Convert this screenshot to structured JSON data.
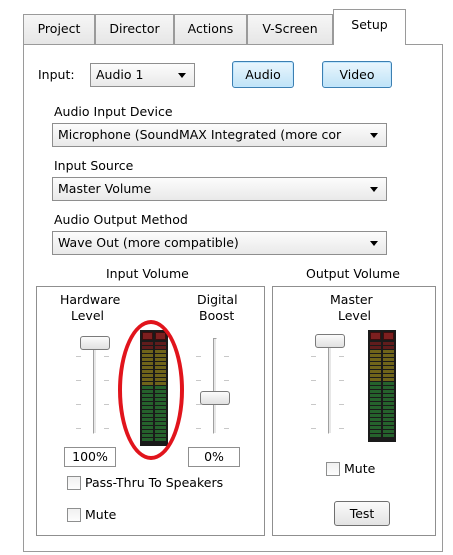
{
  "tabs": [
    {
      "label": "Project"
    },
    {
      "label": "Director"
    },
    {
      "label": "Actions"
    },
    {
      "label": "V-Screen"
    },
    {
      "label": "Setup"
    }
  ],
  "input": {
    "label": "Input:",
    "value": "Audio 1"
  },
  "mode_buttons": {
    "audio": "Audio",
    "video": "Video"
  },
  "audio_input_device": {
    "label": "Audio Input Device",
    "value": "Microphone (SoundMAX Integrated (more cor"
  },
  "input_source": {
    "label": "Input Source",
    "value": "Master Volume"
  },
  "audio_output_method": {
    "label": "Audio Output Method",
    "value": "Wave Out (more compatible)"
  },
  "input_volume": {
    "title": "Input Volume",
    "hardware_level": {
      "label_line1": "Hardware",
      "label_line2": "Level",
      "value": "100%",
      "level_fraction": 1.0
    },
    "digital_boost": {
      "label_line1": "Digital",
      "label_line2": "Boost",
      "value": "0%",
      "level_fraction": 0.0
    },
    "pass_thru": {
      "label": "Pass-Thru To Speakers",
      "checked": false
    },
    "mute": {
      "label": "Mute",
      "checked": false
    }
  },
  "output_volume": {
    "title": "Output Volume",
    "master_level": {
      "label_line1": "Master",
      "label_line2": "Level",
      "level_fraction": 1.0
    },
    "mute": {
      "label": "Mute",
      "checked": false
    },
    "test_button": "Test"
  },
  "colors": {
    "annotation": "#e1141c",
    "button_active": "#bfe3f7",
    "meter_green": "#2f9e3c",
    "meter_yellow": "#b7a21c",
    "meter_red": "#9b1f1f"
  }
}
